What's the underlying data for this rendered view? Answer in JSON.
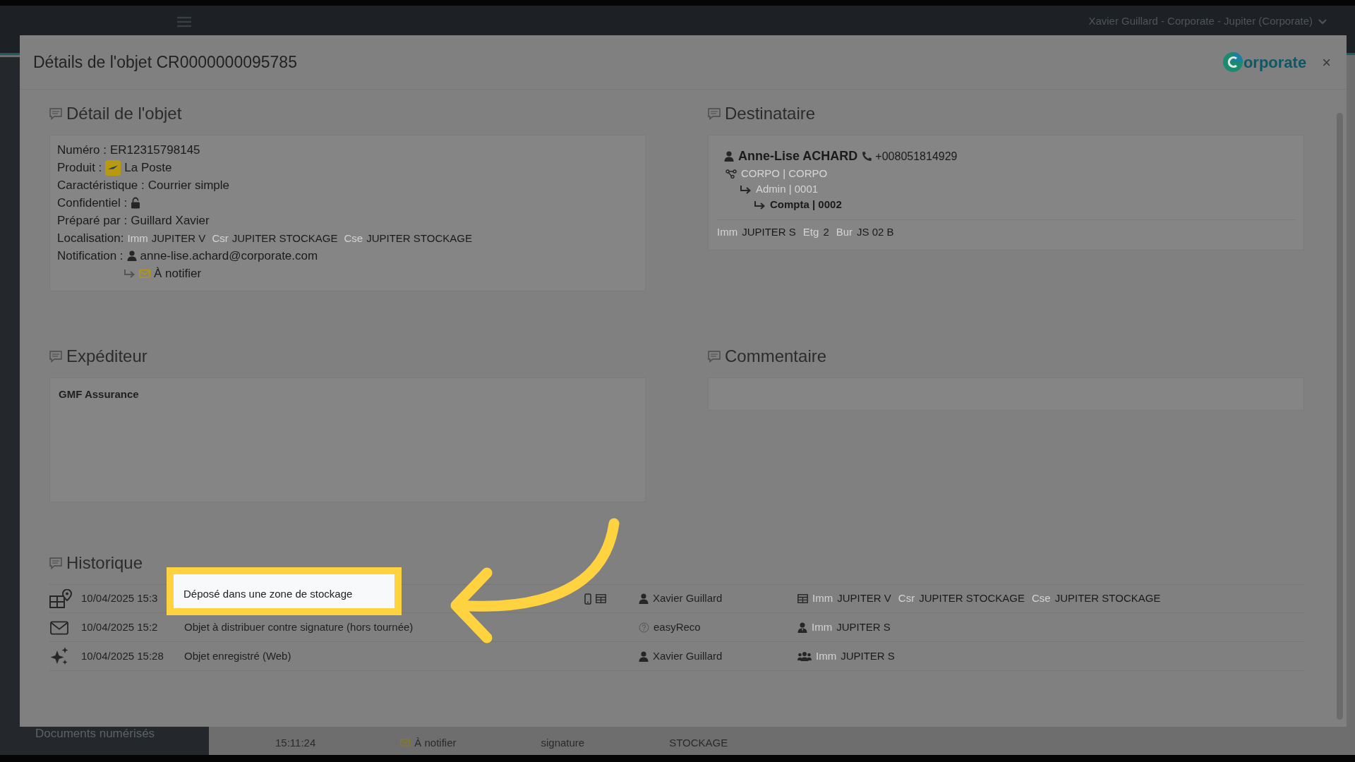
{
  "background": {
    "user_menu": "Xavier Guillard - Corporate - Jupiter (Corporate)",
    "sidebar_item": "Documents numérisés",
    "cells": [
      {
        "kind": "text",
        "text": "15:11:24"
      },
      {
        "kind": "notify",
        "text": "À notifier"
      },
      {
        "kind": "text",
        "text": "signature"
      },
      {
        "kind": "text",
        "text": "STOCKAGE"
      }
    ]
  },
  "modal": {
    "title": "Détails de l'objet CR0000000095785",
    "logo": "orporate",
    "close": "×"
  },
  "detail": {
    "heading": "Détail de l'objet",
    "fields": [
      {
        "kind": "text",
        "label": "Numéro :",
        "value": "ER12315798145"
      },
      {
        "kind": "product",
        "label": "Produit :",
        "value": "La Poste"
      },
      {
        "kind": "text",
        "label": "Caractéristique :",
        "value": "Courrier simple"
      },
      {
        "kind": "lock",
        "label": "Confidentiel :",
        "locked": false
      },
      {
        "kind": "text",
        "label": "Préparé par :",
        "value": "Guillard Xavier"
      },
      {
        "kind": "location",
        "label": "Localisation:",
        "parts": [
          {
            "tag": "Imm",
            "value": "JUPITER V"
          },
          {
            "tag": "Csr",
            "value": "JUPITER STOCKAGE"
          },
          {
            "tag": "Cse",
            "value": "JUPITER STOCKAGE"
          }
        ]
      },
      {
        "kind": "notification",
        "label": "Notification :",
        "value": "anne-lise.achard@corporate.com",
        "status": "À notifier"
      }
    ]
  },
  "recipient": {
    "heading": "Destinataire",
    "name": "Anne-Lise ACHARD",
    "phone": "+008051814929",
    "org": {
      "text": "CORPO | CORPO",
      "current": false,
      "children": [
        {
          "text": "Admin | 0001",
          "current": false,
          "children": [
            {
              "text": "Compta | 0002",
              "current": true
            }
          ]
        }
      ]
    },
    "location": [
      {
        "tag": "Imm",
        "value": "JUPITER S"
      },
      {
        "tag": "Etg",
        "value": "2"
      },
      {
        "tag": "Bur",
        "value": "JS 02 B"
      }
    ]
  },
  "sender": {
    "heading": "Expéditeur",
    "name": "GMF Assurance"
  },
  "comment": {
    "heading": "Commentaire"
  },
  "history": {
    "heading": "Historique",
    "rows": [
      {
        "kind": "storage",
        "date": "10/04/2025 15:3",
        "description": "Déposé dans une zone de stockage",
        "highlighted": true,
        "devices": true,
        "actor": {
          "kind": "user",
          "name": "Xavier Guillard"
        },
        "place": {
          "kind": "storage",
          "parts": [
            {
              "tag": "Imm",
              "value": "JUPITER V"
            },
            {
              "tag": "Csr",
              "value": "JUPITER STOCKAGE"
            },
            {
              "tag": "Cse",
              "value": "JUPITER STOCKAGE"
            }
          ]
        }
      },
      {
        "kind": "mail",
        "date": "10/04/2025 15:2",
        "description": "Objet à distribuer contre signature (hors tournée)",
        "highlighted": false,
        "devices": false,
        "actor": {
          "kind": "unknown",
          "name": "easyReco"
        },
        "place": {
          "kind": "person",
          "parts": [
            {
              "tag": "Imm",
              "value": "JUPITER S"
            }
          ]
        }
      },
      {
        "kind": "created",
        "date": "10/04/2025 15:28",
        "description": "Objet enregistré (Web)",
        "highlighted": false,
        "devices": false,
        "actor": {
          "kind": "user",
          "name": "Xavier Guillard"
        },
        "place": {
          "kind": "group",
          "parts": [
            {
              "tag": "Imm",
              "value": "JUPITER S"
            }
          ]
        }
      }
    ]
  }
}
